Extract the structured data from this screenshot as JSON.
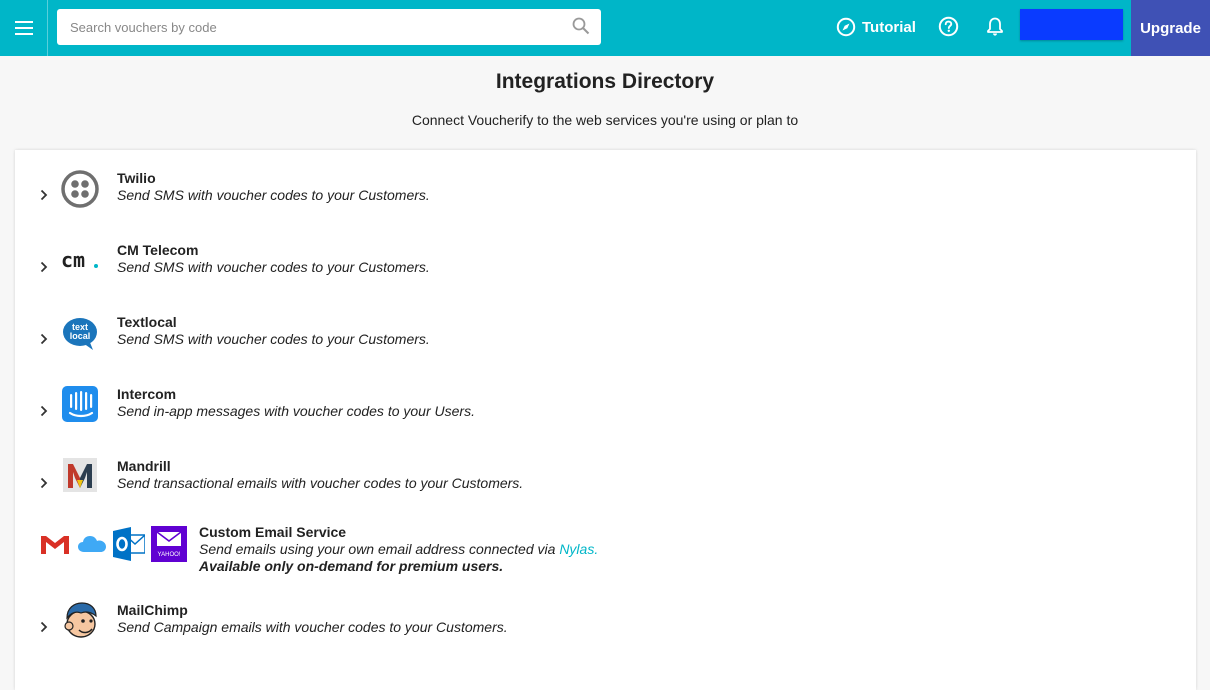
{
  "search": {
    "placeholder": "Search vouchers by code"
  },
  "toolbar": {
    "tutorial_label": "Tutorial",
    "upgrade_label": "Upgrade"
  },
  "page": {
    "title": "Integrations Directory",
    "subtitle": "Connect Voucherify to the web services you're using or plan to"
  },
  "integrations": [
    {
      "name": "Twilio",
      "desc": "Send SMS with voucher codes to your Customers.",
      "icon": "twilio-icon"
    },
    {
      "name": "CM Telecom",
      "desc": "Send SMS with voucher codes to your Customers.",
      "icon": "cm-telecom-icon",
      "logo_text": "cm"
    },
    {
      "name": "Textlocal",
      "desc": "Send SMS with voucher codes to your Customers.",
      "icon": "textlocal-icon",
      "logo_text_1": "text",
      "logo_text_2": "local"
    },
    {
      "name": "Intercom",
      "desc": "Send in-app messages with voucher codes to your Users.",
      "icon": "intercom-icon"
    },
    {
      "name": "Mandrill",
      "desc": "Send transactional emails with voucher codes to your Customers.",
      "icon": "mandrill-icon",
      "logo_text": "M"
    },
    {
      "name": "Custom Email Service",
      "desc": "Send emails using your own email address connected via",
      "link": "Nylas.",
      "note": "Available only on-demand for premium users.",
      "icons": [
        "gmail-icon",
        "icloud-icon",
        "outlook-icon",
        "yahoo-icon"
      ],
      "yahoo_text": "YAHOO!"
    },
    {
      "name": "MailChimp",
      "desc": "Send Campaign emails with voucher codes to your Customers.",
      "icon": "mailchimp-icon"
    }
  ],
  "colors": {
    "topbar": "#00b6c8",
    "upgrade": "#3f51b5",
    "blue_button": "#0a3bff",
    "link": "#00b6c8"
  }
}
